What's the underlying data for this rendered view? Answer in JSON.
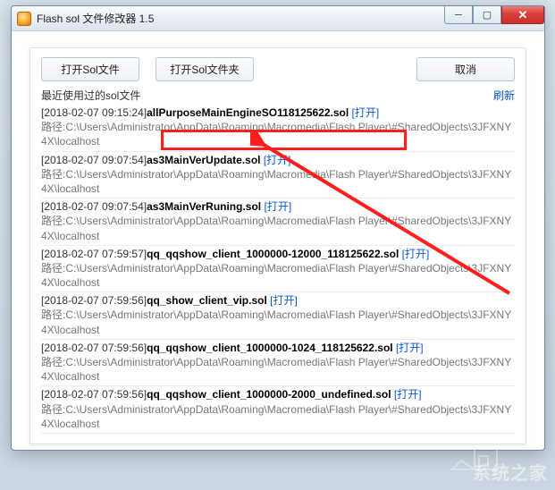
{
  "window": {
    "title": "Flash sol 文件修改器 1.5"
  },
  "toolbar": {
    "open_file": "打开Sol文件",
    "open_folder": "打开Sol文件夹",
    "cancel": "取消"
  },
  "recent": {
    "label": "最近使用过的sol文件",
    "refresh": "刷新"
  },
  "open_label": "[打开]",
  "path_prefix": "路径:",
  "entries": [
    {
      "ts": "[2018-02-07 09:15:24]",
      "name": "allPurposeMainEngineSO118125622.sol",
      "path": "C:\\Users\\Administrator\\AppData\\Roaming\\Macromedia\\Flash Player\\#SharedObjects\\3JFXNY4X\\localhost"
    },
    {
      "ts": "[2018-02-07 09:07:54]",
      "name": "as3MainVerUpdate.sol",
      "path": "C:\\Users\\Administrator\\AppData\\Roaming\\Macromedia\\Flash Player\\#SharedObjects\\3JFXNY4X\\localhost"
    },
    {
      "ts": "[2018-02-07 09:07:54]",
      "name": "as3MainVerRuning.sol",
      "path": "C:\\Users\\Administrator\\AppData\\Roaming\\Macromedia\\Flash Player\\#SharedObjects\\3JFXNY4X\\localhost"
    },
    {
      "ts": "[2018-02-07 07:59:57]",
      "name": "qq_qqshow_client_1000000-12000_118125622.sol",
      "path": "C:\\Users\\Administrator\\AppData\\Roaming\\Macromedia\\Flash Player\\#SharedObjects\\3JFXNY4X\\localhost"
    },
    {
      "ts": "[2018-02-07 07:59:56]",
      "name": "qq_show_client_vip.sol",
      "path": "C:\\Users\\Administrator\\AppData\\Roaming\\Macromedia\\Flash Player\\#SharedObjects\\3JFXNY4X\\localhost"
    },
    {
      "ts": "[2018-02-07 07:59:56]",
      "name": "qq_qqshow_client_1000000-1024_118125622.sol",
      "path": "C:\\Users\\Administrator\\AppData\\Roaming\\Macromedia\\Flash Player\\#SharedObjects\\3JFXNY4X\\localhost"
    },
    {
      "ts": "[2018-02-07 07:59:56]",
      "name": "qq_qqshow_client_1000000-2000_undefined.sol",
      "path": "C:\\Users\\Administrator\\AppData\\Roaming\\Macromedia\\Flash Player\\#SharedObjects\\3JFXNY4X\\localhost"
    }
  ],
  "watermark": "系统之家"
}
